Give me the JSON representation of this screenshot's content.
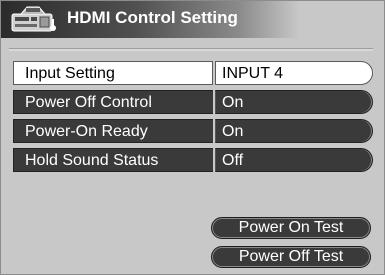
{
  "header": {
    "title": "HDMI Control Setting",
    "icon": "hdmi-device-icon"
  },
  "settings": [
    {
      "label": "Input Setting",
      "value": "INPUT 4",
      "selected": true
    },
    {
      "label": "Power Off Control",
      "value": "On",
      "selected": false
    },
    {
      "label": "Power-On Ready",
      "value": "On",
      "selected": false
    },
    {
      "label": "Hold Sound Status",
      "value": "Off",
      "selected": false
    }
  ],
  "buttons": {
    "power_on_test": "Power On Test",
    "power_off_test": "Power Off Test"
  },
  "colors": {
    "background": "#c8c8c8",
    "row_dark": "#3a3a3a",
    "row_selected": "#ffffff",
    "title_dark": "#2b2b2b"
  }
}
